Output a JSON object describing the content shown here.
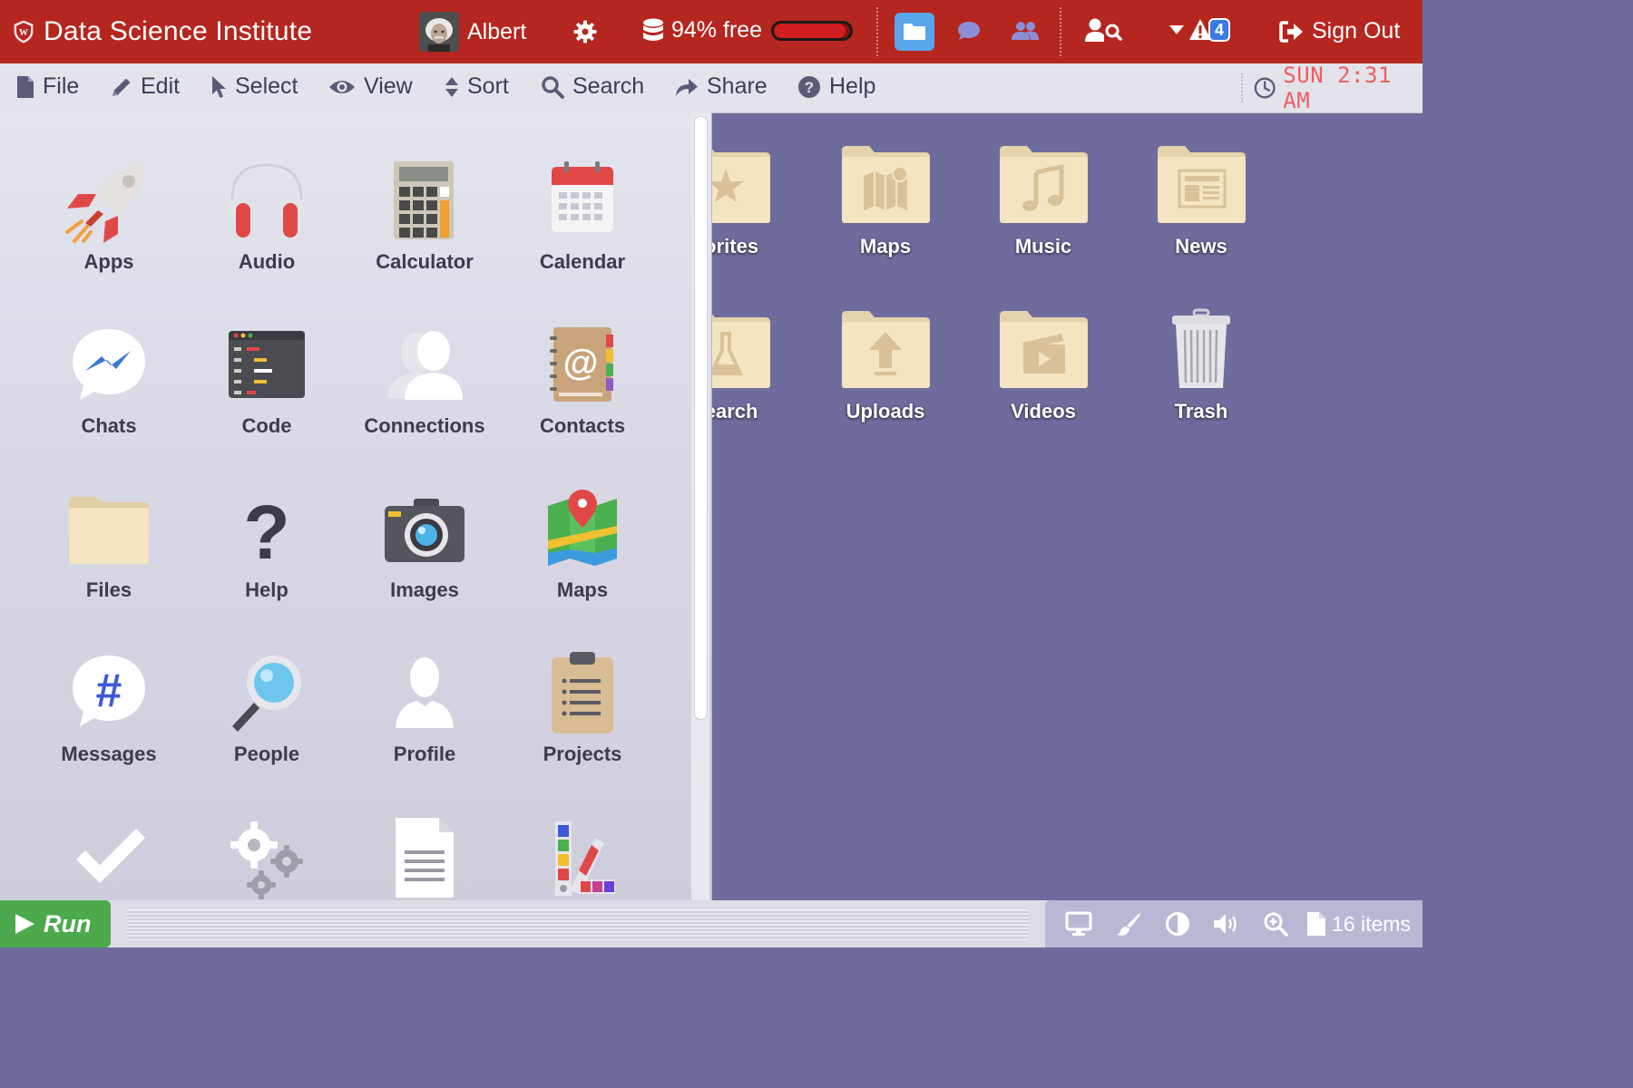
{
  "topbar": {
    "title": "Data Science Institute",
    "user_name": "Albert",
    "storage_text": "94% free",
    "storage_fraction": 0.94,
    "notification_count": "4",
    "sign_out_label": "Sign Out",
    "bg_color": "#b5261f"
  },
  "menubar": {
    "items": [
      "File",
      "Edit",
      "Select",
      "View",
      "Sort",
      "Search",
      "Share",
      "Help"
    ],
    "clock": "SUN 2:31 AM"
  },
  "desktop": {
    "icons": [
      "vorites",
      "Maps",
      "Music",
      "News",
      "search",
      "Uploads",
      "Videos",
      "Trash"
    ]
  },
  "app_menu": {
    "apps": [
      "Apps",
      "Audio",
      "Calculator",
      "Calendar",
      "Chats",
      "Code",
      "Connections",
      "Contacts",
      "Files",
      "Help",
      "Images",
      "Maps",
      "Messages",
      "People",
      "Profile",
      "Projects"
    ],
    "partial_row_icons": [
      "checkmark-icon",
      "settings-icon",
      "document-icon",
      "palette-icon"
    ]
  },
  "bottombar": {
    "run_label": "Run",
    "item_count": "16 items"
  }
}
